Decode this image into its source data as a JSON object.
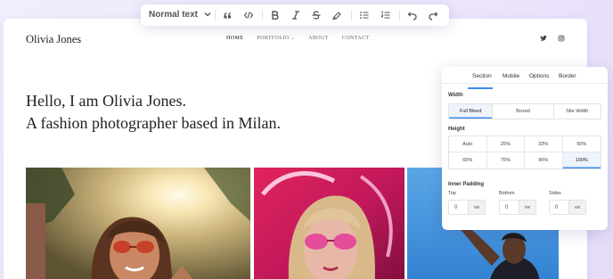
{
  "site": {
    "logo": "Olivia Jones",
    "nav": [
      {
        "label": "HOME",
        "active": true
      },
      {
        "label": "PORTFOLIO",
        "has_dropdown": true
      },
      {
        "label": "ABOUT"
      },
      {
        "label": "CONTACT"
      }
    ],
    "social_icons": [
      "twitter-icon",
      "instagram-icon"
    ],
    "hero_line1": "Hello, I am Olivia Jones.",
    "hero_line2": "A fashion photographer based in Milan.",
    "photos": [
      "woman-sunglasses-sunset-photo",
      "woman-pink-neon-photo",
      "man-blue-sky-photo"
    ]
  },
  "toolbar": {
    "format_select": "Normal text",
    "buttons": [
      "quote-icon",
      "code-icon",
      "bold-icon",
      "italic-icon",
      "strikethrough-icon",
      "highlight-icon",
      "bullet-list-icon",
      "numbered-list-icon",
      "undo-icon",
      "redo-icon"
    ]
  },
  "panel": {
    "tabs": [
      "Section",
      "Mobile",
      "Options",
      "Border"
    ],
    "active_tab": "Section",
    "width_label": "Width",
    "width_options": [
      "Full Bleed",
      "Boxed",
      "Site Width"
    ],
    "width_selected": "Full Bleed",
    "height_label": "Height",
    "height_options": [
      "Auto",
      "25%",
      "33%",
      "50%",
      "60%",
      "75%",
      "90%",
      "100%"
    ],
    "height_selected": "100%",
    "padding_label": "Inner Padding",
    "padding_fields": [
      {
        "label": "Top",
        "value": "0",
        "unit": "vw"
      },
      {
        "label": "Bottom",
        "value": "0",
        "unit": "vw"
      },
      {
        "label": "Sides",
        "value": "0",
        "unit": "vw"
      }
    ]
  },
  "colors": {
    "accent": "#3d8df0",
    "background": "#ece6fb"
  }
}
